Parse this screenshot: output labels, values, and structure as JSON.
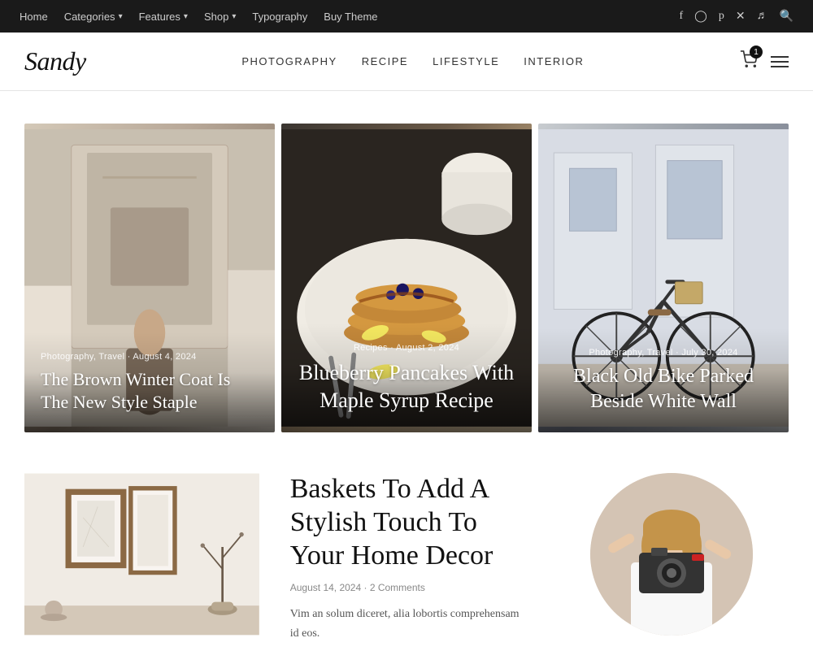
{
  "topBar": {
    "nav": [
      {
        "label": "Home",
        "hasChevron": false
      },
      {
        "label": "Categories",
        "hasChevron": true
      },
      {
        "label": "Features",
        "hasChevron": true
      },
      {
        "label": "Shop",
        "hasChevron": true
      },
      {
        "label": "Typography",
        "hasChevron": false
      },
      {
        "label": "Buy Theme",
        "hasChevron": false
      }
    ],
    "socialIcons": [
      "facebook",
      "instagram",
      "pinterest",
      "x-twitter",
      "tiktok",
      "search"
    ]
  },
  "header": {
    "logo": "Sandy",
    "nav": [
      {
        "label": "PHOTOGRAPHY"
      },
      {
        "label": "RECIPE"
      },
      {
        "label": "LIFESTYLE"
      },
      {
        "label": "INTERIOR"
      }
    ],
    "cartCount": "1"
  },
  "featuredCards": [
    {
      "meta": "Photography, Travel · August 4, 2024",
      "title": "The Brown Winter Coat Is The New Style Staple",
      "imgClass": "img-coat"
    },
    {
      "meta": "Recipes · August 2, 2024",
      "title": "Blueberry Pancakes With Maple Syrup Recipe",
      "imgClass": "img-pancakes"
    },
    {
      "meta": "Photography, Travel · July 30, 2024",
      "title": "Black Old Bike Parked Beside White Wall",
      "imgClass": "img-bike"
    }
  ],
  "bottomSection": {
    "article": {
      "title": "Baskets To Add A Stylish Touch To Your Home Decor",
      "meta": "August 14, 2024 · 2 Comments",
      "excerpt": "Vim an solum diceret, alia lobortis comprehensam id eos."
    },
    "leftImgClass": "img-interior",
    "rightImgClass": "img-avatar"
  }
}
